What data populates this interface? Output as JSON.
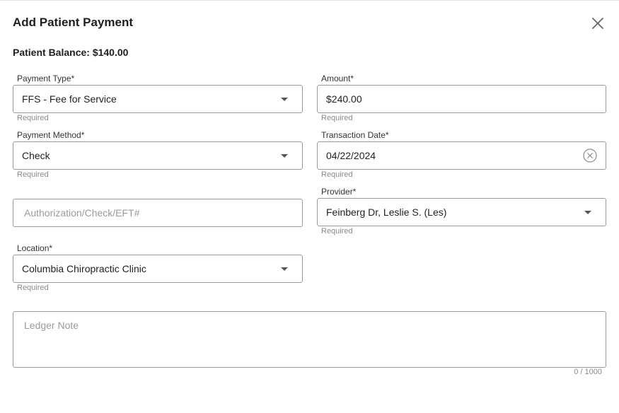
{
  "dialog": {
    "title": "Add Patient Payment",
    "balance": "Patient Balance: $140.00"
  },
  "form": {
    "payment_type": {
      "label": "Payment Type*",
      "value": "FFS - Fee for Service",
      "hint": "Required"
    },
    "amount": {
      "label": "Amount*",
      "value": "$240.00",
      "hint": "Required"
    },
    "payment_method": {
      "label": "Payment Method*",
      "value": "Check",
      "hint": "Required"
    },
    "transaction_date": {
      "label": "Transaction Date*",
      "value": "04/22/2024",
      "hint": "Required"
    },
    "auth_check": {
      "placeholder": "Authorization/Check/EFT#"
    },
    "provider": {
      "label": "Provider*",
      "value": "Feinberg Dr, Leslie S. (Les)",
      "hint": "Required"
    },
    "location": {
      "label": "Location*",
      "value": "Columbia Chiropractic Clinic",
      "hint": "Required"
    },
    "ledger_note": {
      "placeholder": "Ledger Note",
      "counter": "0 / 1000"
    }
  },
  "icons": {
    "close": "close-icon",
    "dropdown": "chevron-down-icon",
    "clear": "clear-circle-icon"
  }
}
